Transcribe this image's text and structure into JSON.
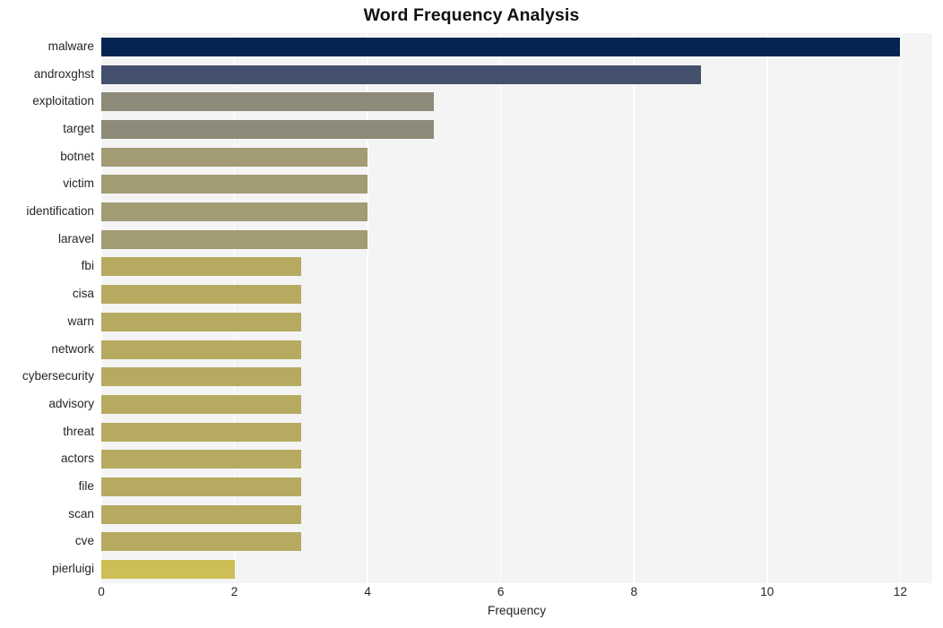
{
  "chart_data": {
    "type": "bar",
    "orientation": "horizontal",
    "title": "Word Frequency Analysis",
    "xlabel": "Frequency",
    "ylabel": "",
    "categories": [
      "malware",
      "androxghst",
      "exploitation",
      "target",
      "botnet",
      "victim",
      "identification",
      "laravel",
      "fbi",
      "cisa",
      "warn",
      "network",
      "cybersecurity",
      "advisory",
      "threat",
      "actors",
      "file",
      "scan",
      "cve",
      "pierluigi"
    ],
    "values": [
      12,
      9,
      5,
      5,
      4,
      4,
      4,
      4,
      3,
      3,
      3,
      3,
      3,
      3,
      3,
      3,
      3,
      3,
      3,
      2
    ],
    "bar_colors": [
      "#04254f",
      "#454f6e",
      "#8e8a79",
      "#8e8a79",
      "#a29b74",
      "#a29b74",
      "#a29b74",
      "#a29b74",
      "#b6aa61",
      "#b6aa61",
      "#b6aa61",
      "#b6aa61",
      "#b6aa61",
      "#b6aa61",
      "#b6aa61",
      "#b6aa61",
      "#b6aa61",
      "#b6aa61",
      "#b6aa61",
      "#cbbf56"
    ],
    "xlim": [
      0,
      12.48
    ],
    "xticks": [
      0,
      2,
      4,
      6,
      8,
      10,
      12
    ],
    "xtick_labels": [
      "0",
      "2",
      "4",
      "6",
      "8",
      "10",
      "12"
    ],
    "grid": true,
    "grid_axis": "x",
    "grid_color": "#ffffff",
    "plot_background": "#f4f4f5",
    "figure_background": "#ffffff",
    "legend": "none"
  }
}
